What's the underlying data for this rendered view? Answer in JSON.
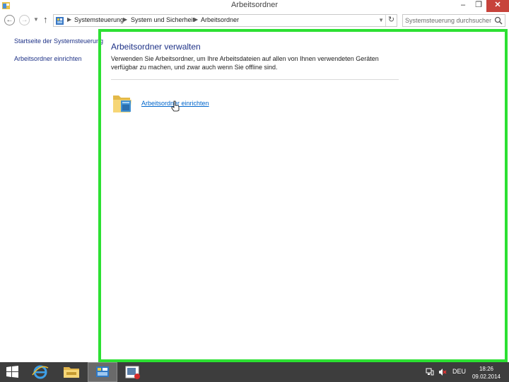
{
  "window": {
    "title": "Arbeitsordner",
    "controls": {
      "minimize": "–",
      "maximize": "❐",
      "close": "✕"
    }
  },
  "nav": {
    "back_icon": "arrow-left-icon",
    "forward_icon": "arrow-right-icon",
    "recent_icon": "chevron-down-icon",
    "up_icon": "arrow-up-icon",
    "breadcrumb": [
      "Systemsteuerung",
      "System und Sicherheit",
      "Arbeitsordner"
    ],
    "search_placeholder": "Systemsteuerung durchsuchen"
  },
  "sidebar": {
    "items": [
      {
        "label": "Startseite der Systemsteuerung"
      },
      {
        "label": "Arbeitsordner einrichten"
      }
    ]
  },
  "main": {
    "heading": "Arbeitsordner verwalten",
    "description": "Verwenden Sie Arbeitsordner, um Ihre Arbeitsdateien auf allen von Ihnen verwendeten Geräten verfügbar zu machen, und zwar auch wenn Sie offline sind.",
    "action_label": "Arbeitsordner einrichten",
    "highlight_color": "#2ce032"
  },
  "taskbar": {
    "items": [
      "start-icon",
      "internet-explorer-icon",
      "file-explorer-icon",
      "control-panel-icon",
      "recorder-icon"
    ],
    "language": "DEU",
    "time": "18:26",
    "date": "09.02.2014"
  }
}
